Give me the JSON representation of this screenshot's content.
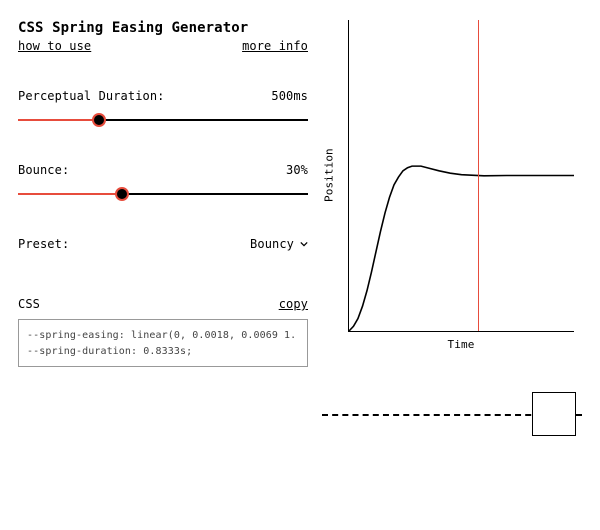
{
  "header": {
    "title": "CSS Spring Easing Generator",
    "how_link": "how to use",
    "more_link": "more info"
  },
  "duration": {
    "label": "Perceptual Duration:",
    "value_text": "500ms",
    "percent": 28
  },
  "bounce": {
    "label": "Bounce:",
    "value_text": "30%",
    "percent": 36
  },
  "preset": {
    "label": "Preset:",
    "selected": "Bouncy"
  },
  "css": {
    "label": "CSS",
    "copy_label": "copy",
    "code": "--spring-easing: linear(0, 0.0018, 0.0069 1.\n--spring-duration: 0.8333s;"
  },
  "chart_data": {
    "type": "line",
    "xlabel": "Time",
    "ylabel": "Position",
    "marker_t": 0.57,
    "x": [
      0.0,
      0.02,
      0.04,
      0.06,
      0.08,
      0.1,
      0.12,
      0.14,
      0.16,
      0.18,
      0.2,
      0.22,
      0.24,
      0.26,
      0.28,
      0.3,
      0.32,
      0.36,
      0.4,
      0.45,
      0.5,
      0.6,
      0.7,
      0.8,
      0.9,
      1.0
    ],
    "y": [
      0.0,
      0.03,
      0.08,
      0.16,
      0.26,
      0.38,
      0.51,
      0.64,
      0.76,
      0.86,
      0.94,
      0.99,
      1.03,
      1.05,
      1.06,
      1.06,
      1.06,
      1.045,
      1.03,
      1.015,
      1.005,
      0.998,
      1.0,
      1.0,
      1.0,
      1.0
    ]
  },
  "colors": {
    "accent": "#e74c3c"
  }
}
